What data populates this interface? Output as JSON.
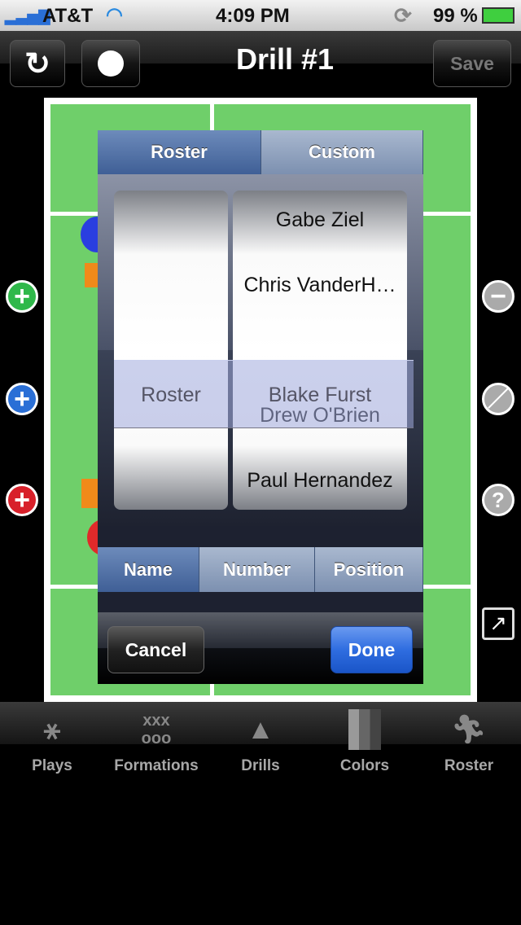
{
  "status_bar": {
    "carrier": "AT&T",
    "time": "4:09 PM",
    "battery": "99 %"
  },
  "nav": {
    "title": "Drill #1",
    "save_label": "Save"
  },
  "picker": {
    "source_tabs": [
      {
        "label": "Roster",
        "selected": true
      },
      {
        "label": "Custom",
        "selected": false
      }
    ],
    "left_column": {
      "selected": "Roster"
    },
    "right_column": [
      "Gabe Ziel",
      "Chris VanderH…",
      "Blake Furst",
      "Drew O'Brien",
      "Paul Hernandez"
    ],
    "selected_name": "Blake Furst",
    "sort_tabs": [
      {
        "label": "Name",
        "selected": true
      },
      {
        "label": "Number",
        "selected": false
      },
      {
        "label": "Position",
        "selected": false
      }
    ],
    "cancel_label": "Cancel",
    "done_label": "Done"
  },
  "tabs": [
    {
      "label": "Plays",
      "icon": "plays-icon"
    },
    {
      "label": "Formations",
      "icon": "formations-icon"
    },
    {
      "label": "Drills",
      "icon": "cone-icon"
    },
    {
      "label": "Colors",
      "icon": "colors-icon"
    },
    {
      "label": "Roster",
      "icon": "lacrosse-player-icon"
    }
  ],
  "colors": {
    "accent": "#2f6de0",
    "field": "#6fcf6a",
    "segment_selected": "#4a6aa0"
  }
}
